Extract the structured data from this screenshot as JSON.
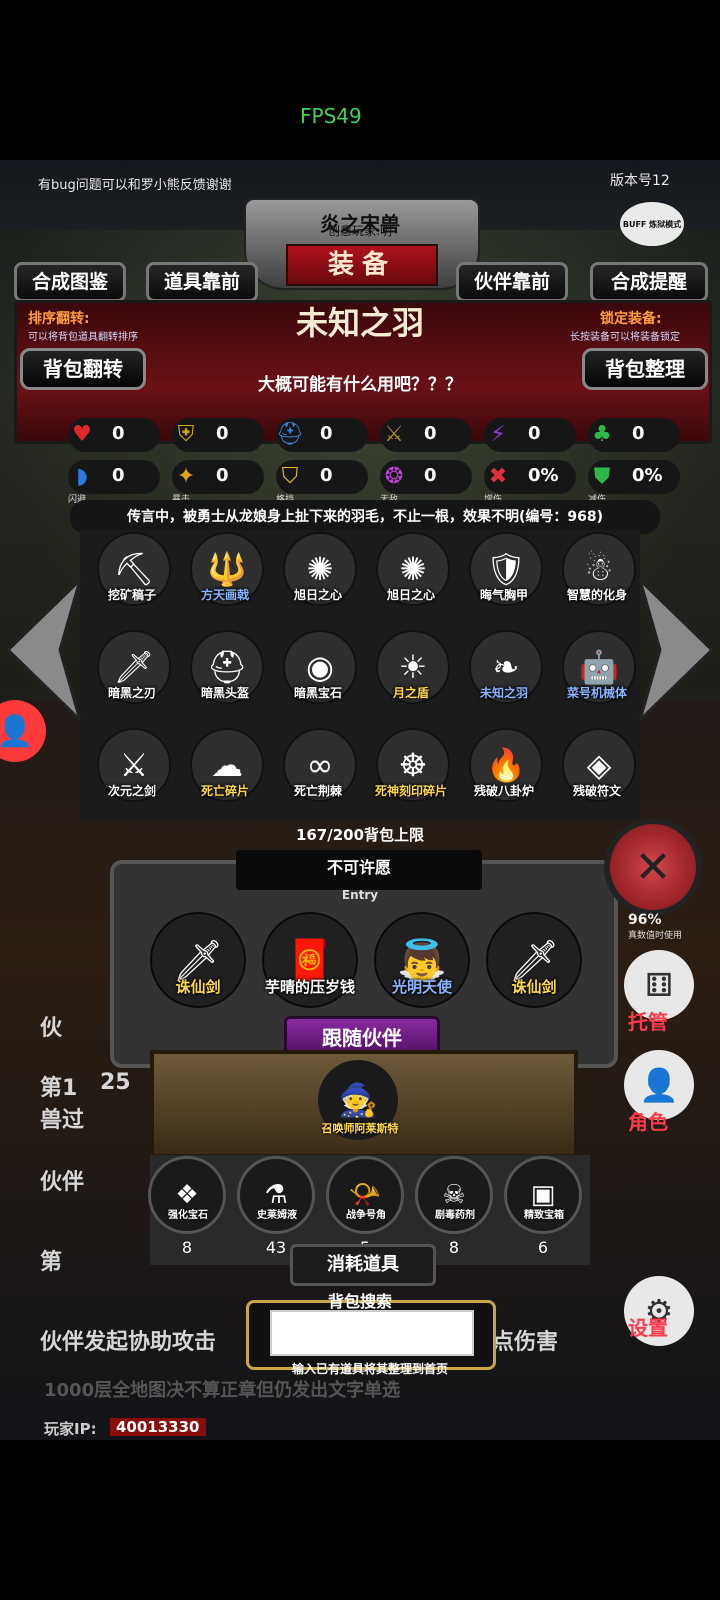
{
  "status": {
    "fps": "FPS49"
  },
  "header": {
    "notice": "有bug问题可以和罗小熊反馈谢谢",
    "version": "版本号12",
    "buff_badge": "BUFF 炼狱模式",
    "title_top": "炎之宋兽",
    "title_sub": "创意玩家:明",
    "title_main": "装备"
  },
  "tabs": [
    "合成图鉴",
    "道具靠前",
    "伙伴靠前",
    "合成提醒"
  ],
  "item": {
    "name": "未知之羽",
    "desc": "大概可能有什么用吧？？？",
    "lore": "传言中，被勇士从龙娘身上扯下来的羽毛，不止一根，效果不明(编号：968)"
  },
  "left_label": {
    "title": "排序翻转:",
    "sub": "可以将背包道具翻转排序"
  },
  "right_label": {
    "title": "锁定装备:",
    "sub": "长按装备可以将装备锁定"
  },
  "side_buttons": {
    "flip": "背包翻转",
    "tidy": "背包整理"
  },
  "stats_row1": [
    {
      "icon": "heart-icon",
      "glyph": "♥",
      "color": "#e0262c",
      "value": "0",
      "label": ""
    },
    {
      "icon": "armor-icon",
      "glyph": "⛨",
      "color": "#d4a21c",
      "value": "0",
      "label": ""
    },
    {
      "icon": "helmet-icon",
      "glyph": "⛑",
      "color": "#3a86d8",
      "value": "0",
      "label": ""
    },
    {
      "icon": "sword-icon",
      "glyph": "⚔",
      "color": "#b08a30",
      "value": "0",
      "label": ""
    },
    {
      "icon": "lightning-icon",
      "glyph": "⚡",
      "color": "#8a3ad8",
      "value": "0",
      "label": ""
    },
    {
      "icon": "clover-icon",
      "glyph": "♣",
      "color": "#2fb84a",
      "value": "0",
      "label": ""
    }
  ],
  "stats_row2": [
    {
      "icon": "dodge-icon",
      "glyph": "◗",
      "color": "#2f7ae0",
      "value": "0",
      "label": "闪避"
    },
    {
      "icon": "crit-icon",
      "glyph": "✦",
      "color": "#e0a020",
      "value": "0",
      "label": "暴击"
    },
    {
      "icon": "block-icon",
      "glyph": "⛉",
      "color": "#e0c020",
      "value": "0",
      "label": "格挡"
    },
    {
      "icon": "invincible-icon",
      "glyph": "❂",
      "color": "#c040d8",
      "value": "0",
      "label": "无敌"
    },
    {
      "icon": "dmg-up-icon",
      "glyph": "✖",
      "color": "#e03040",
      "value": "0%",
      "label": "增伤"
    },
    {
      "icon": "dmg-down-icon",
      "glyph": "⛊",
      "color": "#2fb84a",
      "value": "0%",
      "label": "减伤"
    }
  ],
  "inventory": [
    {
      "name": "挖矿稿子",
      "color": "#ffffff",
      "glyph": "⛏"
    },
    {
      "name": "方天画戟",
      "color": "#8ab4ff",
      "glyph": "🔱"
    },
    {
      "name": "旭日之心",
      "color": "#ffffff",
      "glyph": "✺"
    },
    {
      "name": "旭日之心",
      "color": "#ffffff",
      "glyph": "✺"
    },
    {
      "name": "晦气胸甲",
      "color": "#ffffff",
      "glyph": "🛡"
    },
    {
      "name": "智慧的化身",
      "color": "#ffffff",
      "glyph": "☃"
    },
    {
      "name": "暗黑之刃",
      "color": "#ffffff",
      "glyph": "🗡"
    },
    {
      "name": "暗黑头盔",
      "color": "#ffffff",
      "glyph": "⛑"
    },
    {
      "name": "暗黑宝石",
      "color": "#ffffff",
      "glyph": "◉"
    },
    {
      "name": "月之盾",
      "color": "#ffd84a",
      "glyph": "☀"
    },
    {
      "name": "未知之羽",
      "color": "#8ab4ff",
      "glyph": "❧"
    },
    {
      "name": "菜号机械体",
      "color": "#8ab4ff",
      "glyph": "🤖"
    },
    {
      "name": "次元之剑",
      "color": "#ffffff",
      "glyph": "⚔"
    },
    {
      "name": "死亡碎片",
      "color": "#ffd84a",
      "glyph": "☁"
    },
    {
      "name": "死亡荆棘",
      "color": "#ffffff",
      "glyph": "∞"
    },
    {
      "name": "死神刻印碎片",
      "color": "#ffd84a",
      "glyph": "☸"
    },
    {
      "name": "残破八卦炉",
      "color": "#ffffff",
      "glyph": "🔥"
    },
    {
      "name": "残破符文",
      "color": "#ffffff",
      "glyph": "◈"
    }
  ],
  "bag_capacity": "167/200背包上限",
  "wish": {
    "title": "不可许愿",
    "entry": "Entry"
  },
  "wish_items": [
    {
      "name": "诛仙剑",
      "color": "#ffd84a",
      "glyph": "🗡"
    },
    {
      "name": "芋晴的压岁钱",
      "color": "#ffffff",
      "glyph": "🧧"
    },
    {
      "name": "光明天使",
      "color": "#8ab4ff",
      "glyph": "👼"
    },
    {
      "name": "诛仙剑",
      "color": "#ffd84a",
      "glyph": "🗡"
    }
  ],
  "follow": {
    "title": "跟随伙伴",
    "partner_name": "召唤师阿莱斯特"
  },
  "consumables": [
    {
      "name": "强化宝石",
      "count": "8",
      "glyph": "❖"
    },
    {
      "name": "史莱姆液",
      "count": "43",
      "glyph": "⚗"
    },
    {
      "name": "战争号角",
      "count": "5",
      "glyph": "📯"
    },
    {
      "name": "剧毒药剂",
      "count": "8",
      "glyph": "☠"
    },
    {
      "name": "精致宝箱",
      "count": "6",
      "glyph": "▣"
    }
  ],
  "consume_label": "消耗道具",
  "search": {
    "label": "背包搜索",
    "hint": "输入已有道具将其整理到首页",
    "value": ""
  },
  "background": {
    "t1": "伙",
    "t2": "第1",
    "t3": "25",
    "t4": "兽过",
    "t5": "伙伴",
    "t6": "第",
    "t7": "伙伴发起协助攻击",
    "t8": "点伤害",
    "t9": "1000层全地图决不算正章但仍发出文字单选"
  },
  "right_panel": {
    "pct": "96%",
    "pct_sub": "真数值时使用",
    "manage": "托管",
    "role": "角色",
    "settings": "设置"
  },
  "player_ip": {
    "label": "玩家IP:",
    "value": "40013330"
  }
}
